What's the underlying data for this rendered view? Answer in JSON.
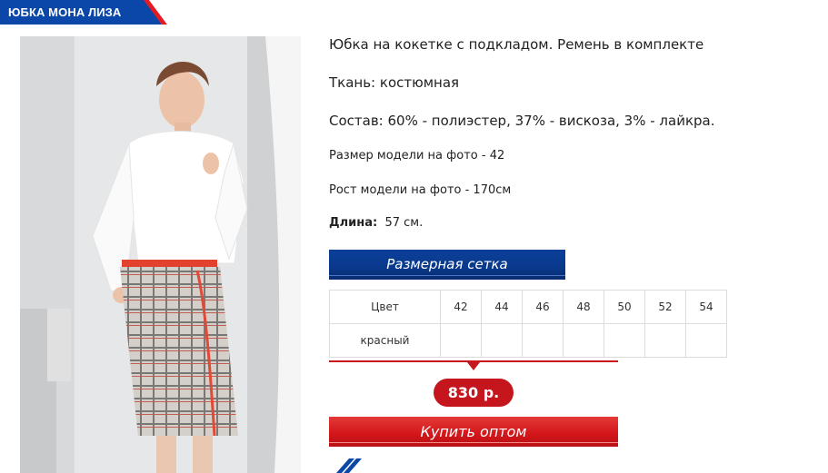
{
  "product": {
    "title": "ЮБКА МОНА ЛИЗА",
    "description": [
      "Юбка на кокетке с подкладом. Ремень в комплекте",
      "Ткань: костюмная",
      "Состав: 60% - полиэстер, 37% - вискоза, 3% - лайкра.",
      "Размер модели на фото - 42",
      "Рост модели на фото - 170см"
    ],
    "length_label": "Длина:",
    "length_value": "57 см.",
    "price": "830 р."
  },
  "buttons": {
    "size_chart": "Размерная сетка",
    "buy_wholesale": "Купить оптом"
  },
  "size_table": {
    "header_label": "Цвет",
    "sizes": [
      "42",
      "44",
      "46",
      "48",
      "50",
      "52",
      "54"
    ],
    "rows": [
      {
        "color": "красный",
        "cells": [
          "",
          "",
          "",
          "",
          "",
          "",
          ""
        ]
      }
    ]
  },
  "colors": {
    "brand_blue": "#0a47a8",
    "brand_red": "#c4161c"
  }
}
